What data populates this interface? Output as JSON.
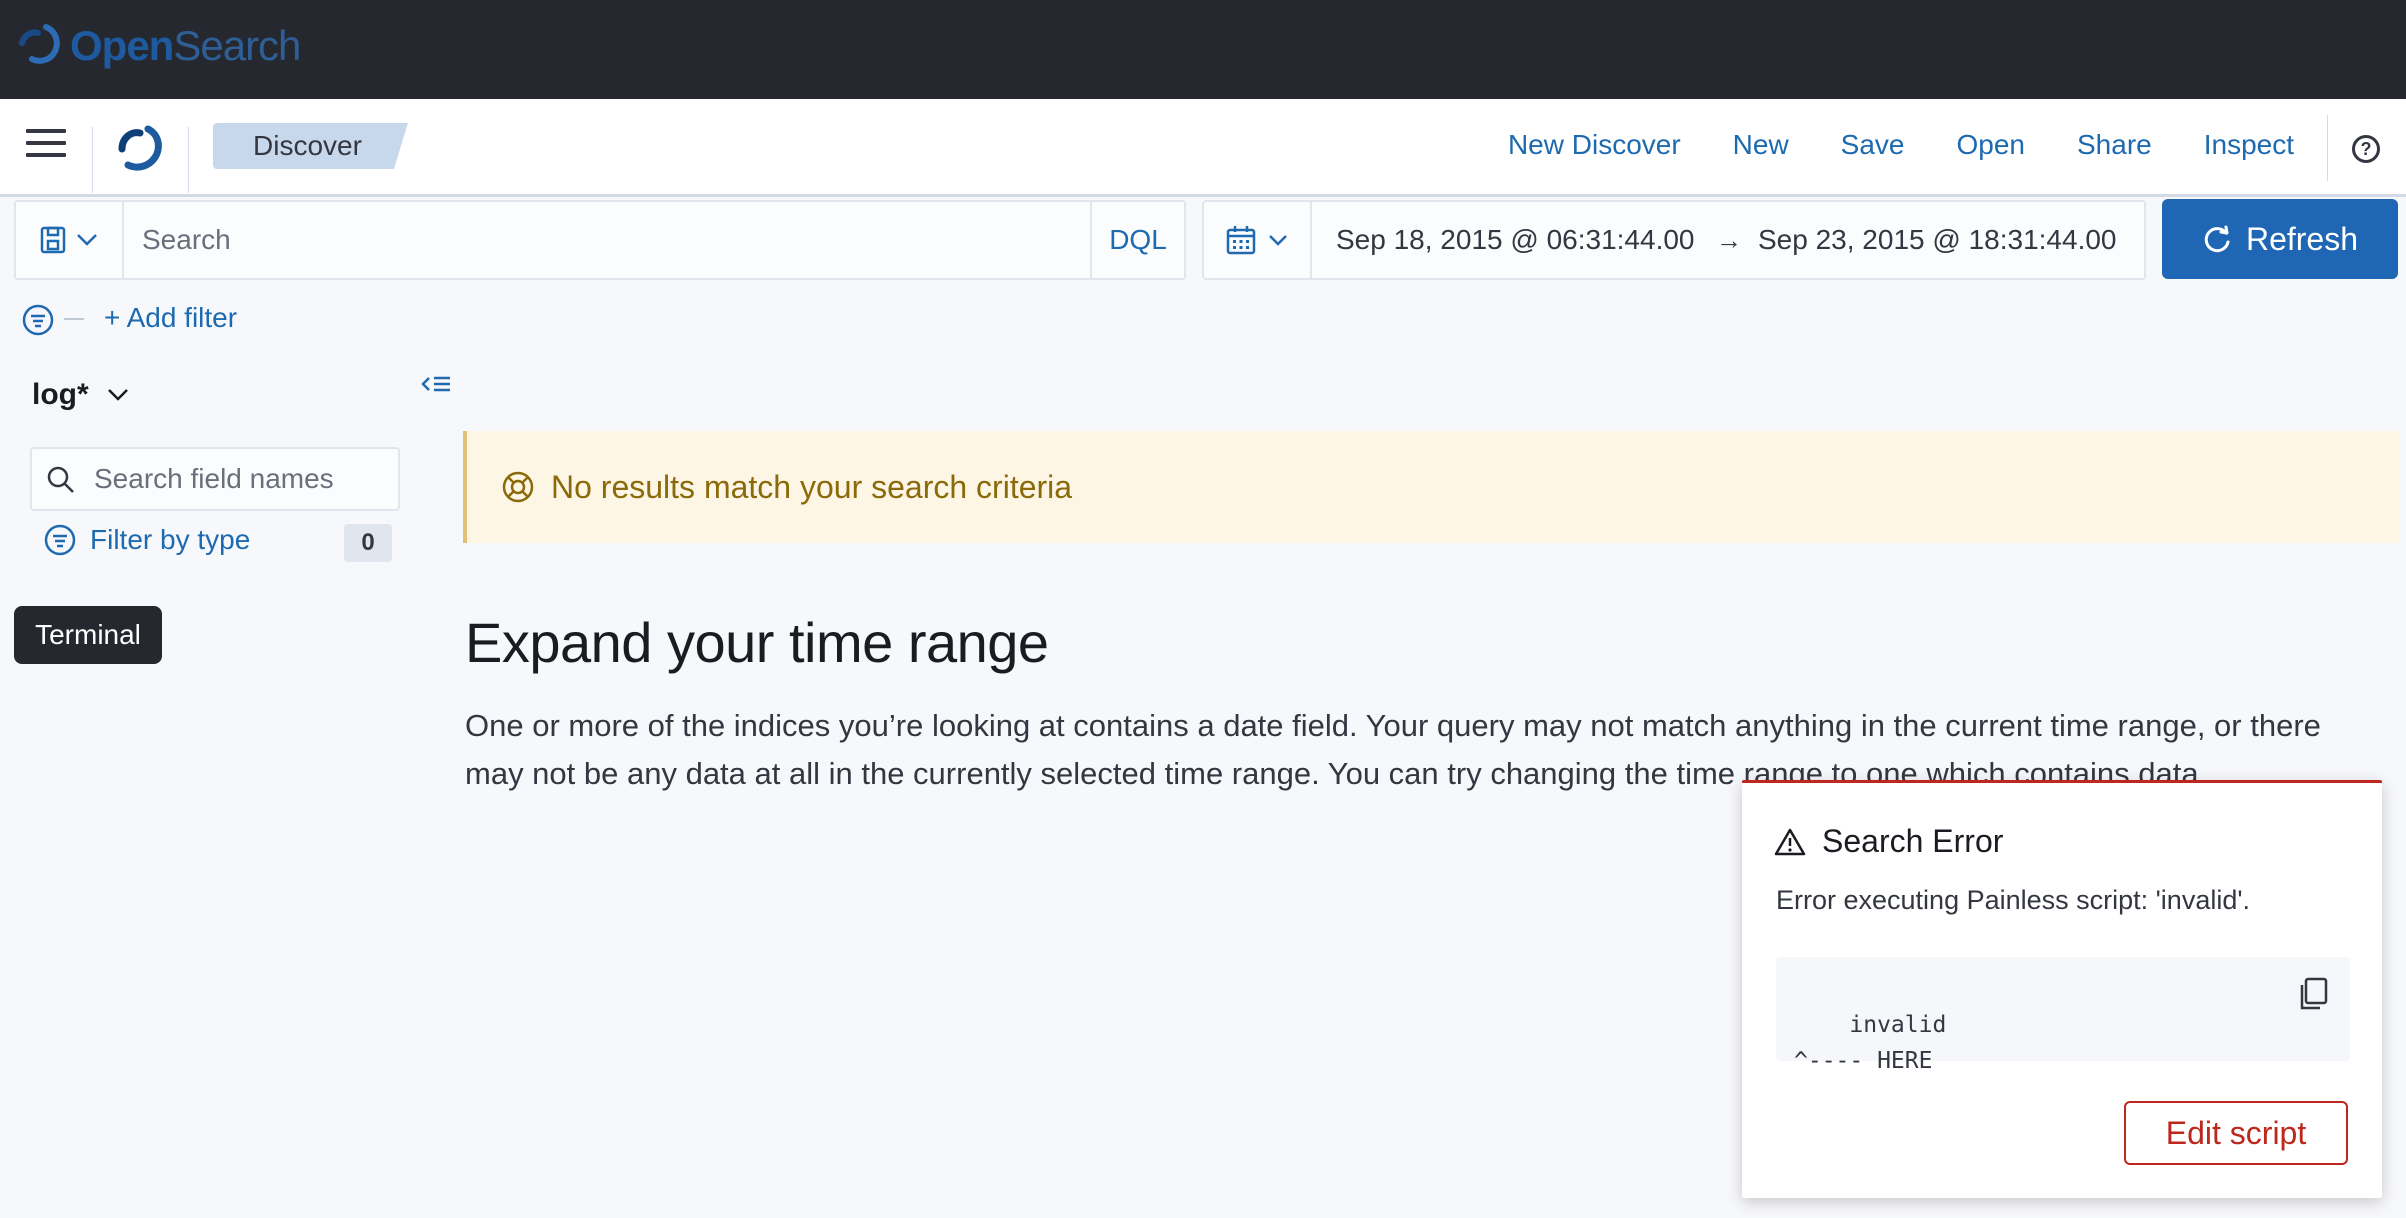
{
  "brand": {
    "name_primary": "Open",
    "name_secondary": "Search"
  },
  "header": {
    "breadcrumb": "Discover",
    "links": [
      "New Discover",
      "New",
      "Save",
      "Open",
      "Share",
      "Inspect"
    ],
    "help_icon": "help-icon"
  },
  "query": {
    "placeholder": "Search",
    "language": "DQL"
  },
  "date_range": {
    "start": "Sep 18, 2015 @ 06:31:44.00",
    "arrow": "→",
    "end": "Sep 23, 2015 @ 18:31:44.00"
  },
  "refresh_label": "Refresh",
  "filters": {
    "add_label": "+ Add filter"
  },
  "sidebar": {
    "index_pattern": "log*",
    "field_search_placeholder": "Search field names",
    "filter_by_type_label": "Filter by type",
    "filter_count": "0",
    "tooltip": "Terminal"
  },
  "main": {
    "callout": "No results match your search criteria",
    "heading": "Expand your time range",
    "body": "One or more of the indices you’re looking at contains a date field. Your query may not match anything in the current time range, or there may not be any data at all in the currently selected time range. You can try changing the time range to one which contains data."
  },
  "toast": {
    "title": "Search Error",
    "message": "Error executing Painless script: 'invalid'.",
    "code": "invalid\n^---- HERE",
    "button": "Edit script"
  },
  "colors": {
    "brand_bar": "#25282f",
    "primary": "#1f67b5",
    "link": "#1e6ab0",
    "danger": "#bd271e",
    "warning_bg": "#fef6e4"
  }
}
